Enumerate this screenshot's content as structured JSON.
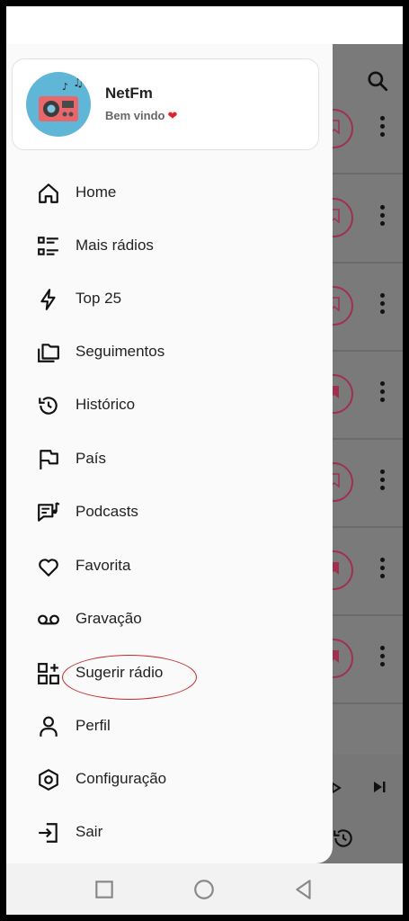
{
  "header": {
    "app_name": "NetFm",
    "welcome": "Bem vindo",
    "heart": "❤"
  },
  "menu": [
    {
      "id": "home",
      "label": "Home",
      "icon": "home-icon"
    },
    {
      "id": "mais-radios",
      "label": "Mais rádios",
      "icon": "list-icon"
    },
    {
      "id": "top-25",
      "label": "Top 25",
      "icon": "bolt-icon"
    },
    {
      "id": "seguimentos",
      "label": "Seguimentos",
      "icon": "folders-icon"
    },
    {
      "id": "historico",
      "label": "Histórico",
      "icon": "history-icon"
    },
    {
      "id": "pais",
      "label": "País",
      "icon": "flag-icon"
    },
    {
      "id": "podcasts",
      "label": "Podcasts",
      "icon": "podcast-icon"
    },
    {
      "id": "favorita",
      "label": "Favorita",
      "icon": "heart-icon"
    },
    {
      "id": "gravacao",
      "label": "Gravação",
      "icon": "voicemail-icon"
    },
    {
      "id": "sugerir-radio",
      "label": "Sugerir rádio",
      "icon": "add-grid-icon"
    },
    {
      "id": "perfil",
      "label": "Perfil",
      "icon": "person-icon"
    },
    {
      "id": "configuracao",
      "label": "Configuração",
      "icon": "settings-icon"
    },
    {
      "id": "sair",
      "label": "Sair",
      "icon": "logout-icon"
    }
  ],
  "colors": {
    "accent": "#a0304f",
    "annotation": "#c0282d"
  },
  "navbar": [
    "recent-apps-icon",
    "home-circle-icon",
    "back-icon"
  ]
}
